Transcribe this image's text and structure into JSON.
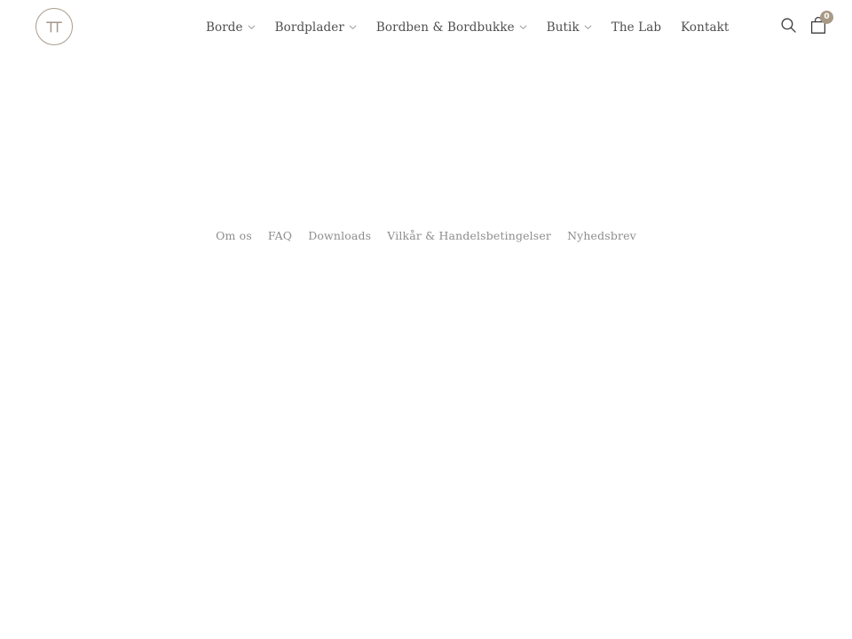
{
  "theme": {
    "background": "#ffffff",
    "nav_text": "#4f4f4f",
    "footer_text": "#8d8d8d",
    "accent": "#a89a86",
    "logo_ring": "#a99c8e",
    "icon": "#3d3d3d",
    "badge_text": "#ffffff"
  },
  "header": {
    "logo": {
      "name": "pi-logo",
      "glyph": "π",
      "icon": "circle-pi-logo-icon"
    },
    "nav": [
      {
        "label": "Borde",
        "has_dropdown": true,
        "icon": "chevron-down-icon"
      },
      {
        "label": "Bordplader",
        "has_dropdown": true,
        "icon": "chevron-down-icon"
      },
      {
        "label": "Bordben & Bordbukke",
        "has_dropdown": true,
        "icon": "chevron-down-icon"
      },
      {
        "label": "Butik",
        "has_dropdown": true,
        "icon": "chevron-down-icon"
      },
      {
        "label": "The Lab",
        "has_dropdown": false,
        "icon": ""
      },
      {
        "label": "Kontakt",
        "has_dropdown": false,
        "icon": ""
      }
    ],
    "actions": {
      "search": {
        "icon": "search-icon",
        "label": "Søg"
      },
      "cart": {
        "icon": "shopping-bag-icon",
        "label": "Indkøbskurv",
        "count": "0"
      }
    }
  },
  "footer": {
    "links": [
      {
        "label": "Om os"
      },
      {
        "label": "FAQ"
      },
      {
        "label": "Downloads"
      },
      {
        "label": "Vilkår & Handelsbetingelser"
      },
      {
        "label": "Nyhedsbrev"
      }
    ]
  }
}
